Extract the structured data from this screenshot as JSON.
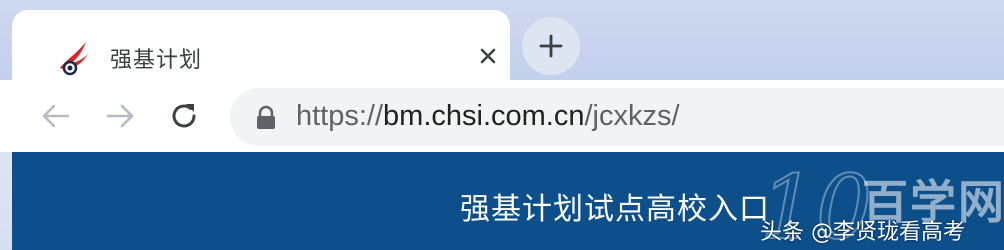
{
  "tab": {
    "title": "强基计划",
    "logo_icon": "red-bird-logo-icon",
    "close_icon": "close-icon"
  },
  "new_tab": {
    "icon": "plus-icon"
  },
  "toolbar": {
    "back_icon": "arrow-left-icon",
    "forward_icon": "arrow-right-icon",
    "reload_icon": "reload-icon"
  },
  "address_bar": {
    "lock_icon": "lock-icon",
    "url_scheme": "https://",
    "url_host": "bm.chsi.com.cn",
    "url_path": "/jcxkzs/"
  },
  "page": {
    "banner_title": "强基计划试点高校入口",
    "banner_color": "#0d4f8b"
  },
  "watermark": {
    "logo_text": "100",
    "site_name": "百学网",
    "credit": "头条 @李贤珑看高考"
  }
}
